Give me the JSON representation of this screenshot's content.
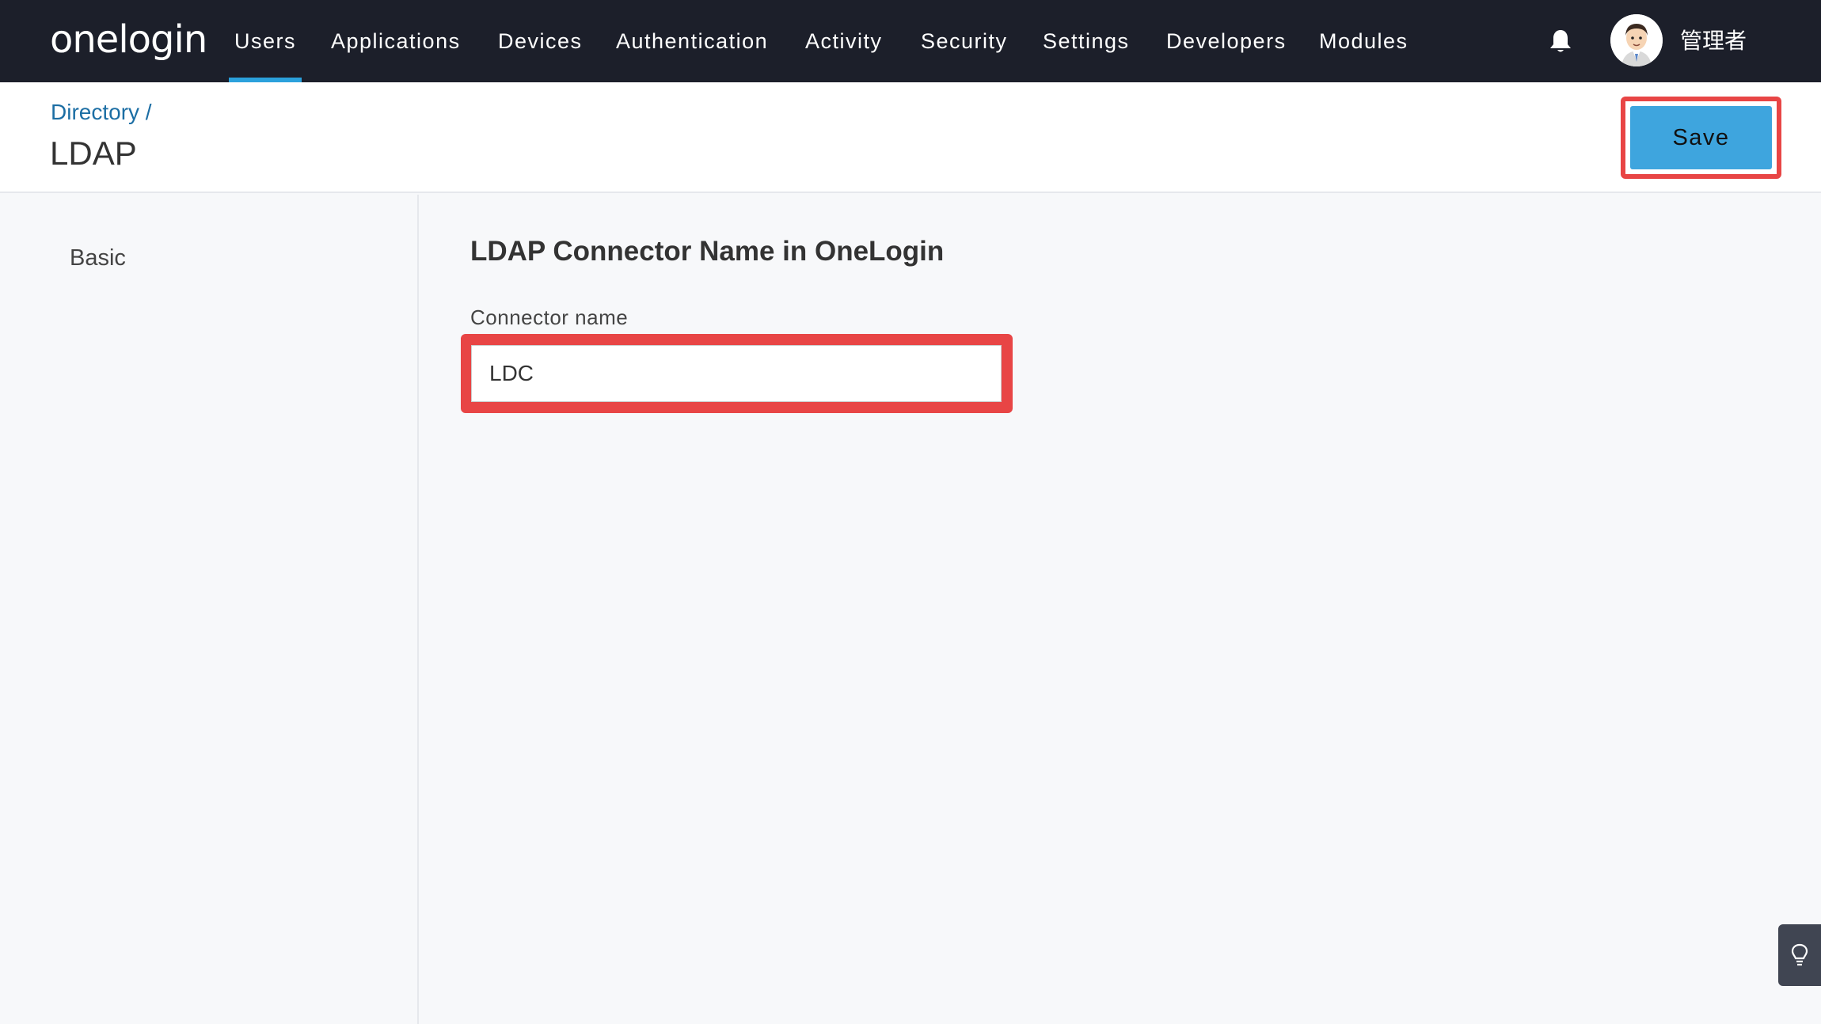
{
  "nav": {
    "logo": "onelogin",
    "items": [
      {
        "label": "Users",
        "active": true
      },
      {
        "label": "Applications"
      },
      {
        "label": "Devices"
      },
      {
        "label": "Authentication"
      },
      {
        "label": "Activity"
      },
      {
        "label": "Security"
      },
      {
        "label": "Settings"
      },
      {
        "label": "Developers"
      },
      {
        "label": "Modules"
      }
    ],
    "bell_icon": "bell-icon",
    "user_name": "管理者"
  },
  "header": {
    "breadcrumb": "Directory /",
    "title": "LDAP",
    "save_label": "Save"
  },
  "sidebar": {
    "items": [
      {
        "label": "Basic"
      }
    ]
  },
  "form": {
    "section_title": "LDAP Connector Name in OneLogin",
    "connector_label": "Connector name",
    "connector_value": "LDC"
  },
  "colors": {
    "nav_bg": "#1c1f2a",
    "accent": "#2ba1dc",
    "save_bg": "#3ea5de",
    "highlight": "#e84545"
  },
  "help_icon": "lightbulb-icon"
}
